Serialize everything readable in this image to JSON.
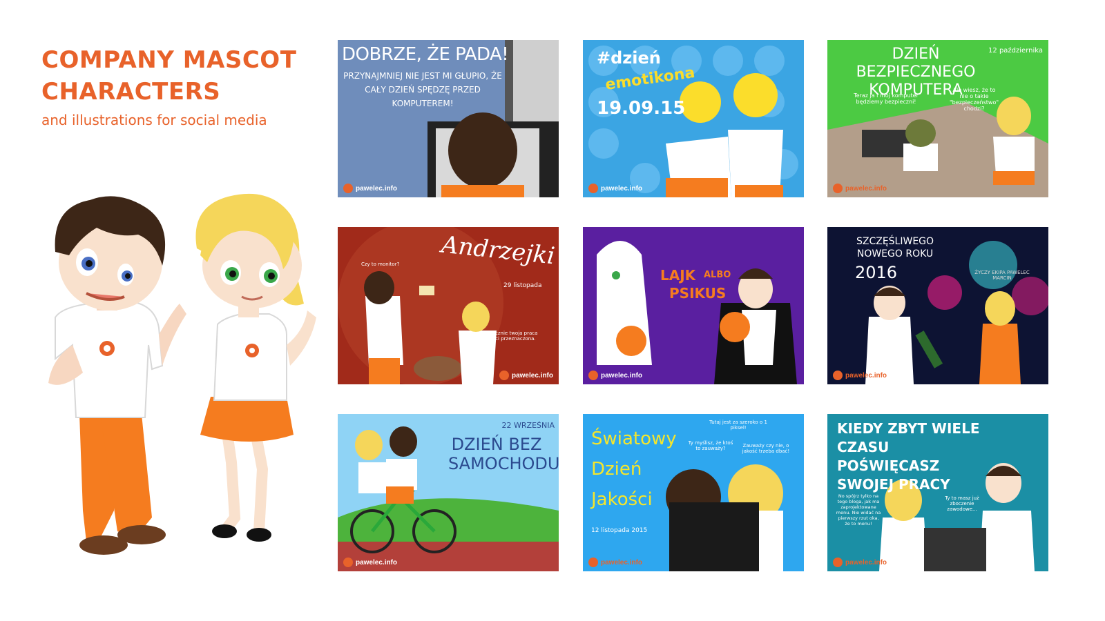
{
  "header": {
    "title": "COMPANY MASCOT CHARACTERS",
    "subtitle": "and illustrations for social media"
  },
  "logo_text": "pawelec.info",
  "tiles": [
    {
      "headline": "DOBRZE, ŻE PADA!",
      "body": "PRZYNAJMNIEJ NIE JEST MI GŁUPIO, ŻE CAŁY DZIEŃ SPĘDZĘ PRZED KOMPUTEREM!"
    },
    {
      "headline": "#dzień",
      "sub": "emotikona",
      "date": "19.09.15"
    },
    {
      "headline": "DZIEŃ BEZPIECZNEGO KOMPUTERA",
      "date": "12 października",
      "bubble1": "Teraz ja i mój komputer będziemy bezpieczni!",
      "bubble2": "Ale wiesz, że to nie o takie \"bezpieczeństwo\" chodzi?"
    },
    {
      "headline": "Andrzejki",
      "date": "29 listopada",
      "bubble1": "Czy to monitor?",
      "bubble2": "Widocznie twoja praca jest ci przeznaczona."
    },
    {
      "headline": "LAJK",
      "mid": "ALBO",
      "tail": "PSIKUS"
    },
    {
      "headline": "SZCZĘŚLIWEGO NOWEGO ROKU",
      "year": "2016",
      "wish": "ŻYCZY EKIPA PAWELEC MARCIN"
    },
    {
      "headline": "DZIEŃ BEZ SAMOCHODU",
      "date": "22 WRZEŚNIA"
    },
    {
      "headline": "Światowy Dzień Jakości",
      "date": "12 listopada 2015",
      "bubble1": "Tutaj jest za szeroko o 1 piksel!",
      "bubble2": "Ty myślisz, że ktoś to zauważy?",
      "bubble3": "Zauważy czy nie, o jakość trzeba dbać!"
    },
    {
      "headline": "KIEDY ZBYT WIELE CZASU POŚWIĘCASZ SWOJEJ PRACY",
      "bubble1": "No spójrz tylko na tego bloga, jak ma zaprojektowane menu. Nie widać na pierwszy rzut oka, że to menu!",
      "bubble2": "Ty to masz już zboczenie zawodowe..."
    }
  ],
  "colors": {
    "accent": "#e8622a"
  }
}
